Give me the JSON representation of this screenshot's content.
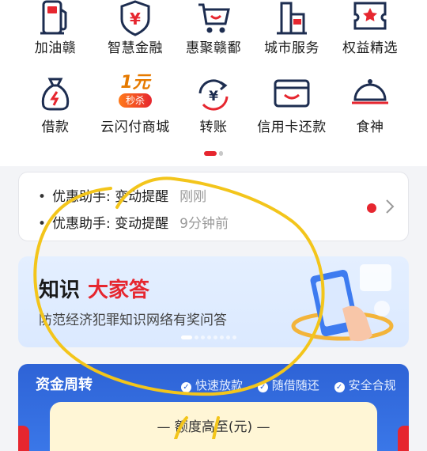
{
  "colors": {
    "brand_red": "#e6262f",
    "blue": "#2e63d6",
    "annotation_yellow": "#f3c51b"
  },
  "services": {
    "row1": [
      {
        "label": "加油赣",
        "icon": "fuel-pump-icon"
      },
      {
        "label": "智慧金融",
        "icon": "yuan-shield-icon"
      },
      {
        "label": "惠聚赣鄱",
        "icon": "shopping-cart-icon"
      },
      {
        "label": "城市服务",
        "icon": "city-building-icon"
      },
      {
        "label": "权益精选",
        "icon": "star-ticket-icon"
      }
    ],
    "row2": [
      {
        "label": "借款",
        "icon": "money-bag-icon"
      },
      {
        "label": "云闪付商城",
        "icon": "flash-sale-icon",
        "badge_top": "1元",
        "badge_bottom": "秒杀"
      },
      {
        "label": "转账",
        "icon": "transfer-icon"
      },
      {
        "label": "信用卡还款",
        "icon": "credit-card-icon"
      },
      {
        "label": "食神",
        "icon": "food-cloche-icon"
      }
    ]
  },
  "pager": {
    "active_index": 0,
    "count": 2
  },
  "notices": [
    {
      "bullet": "•",
      "text": "优惠助手: 变动提醒",
      "time": "刚刚"
    },
    {
      "bullet": "•",
      "text": "优惠助手: 变动提醒",
      "time": "9分钟前"
    }
  ],
  "banner": {
    "title_part1": "知识",
    "title_part2": "大家答",
    "subtitle": "防范经济犯罪知识网络有奖问答"
  },
  "funds": {
    "title": "资金周转",
    "tags": [
      "快速放款",
      "随借随还",
      "安全合规"
    ],
    "quota_label": "—  额度高至(元)  —"
  }
}
